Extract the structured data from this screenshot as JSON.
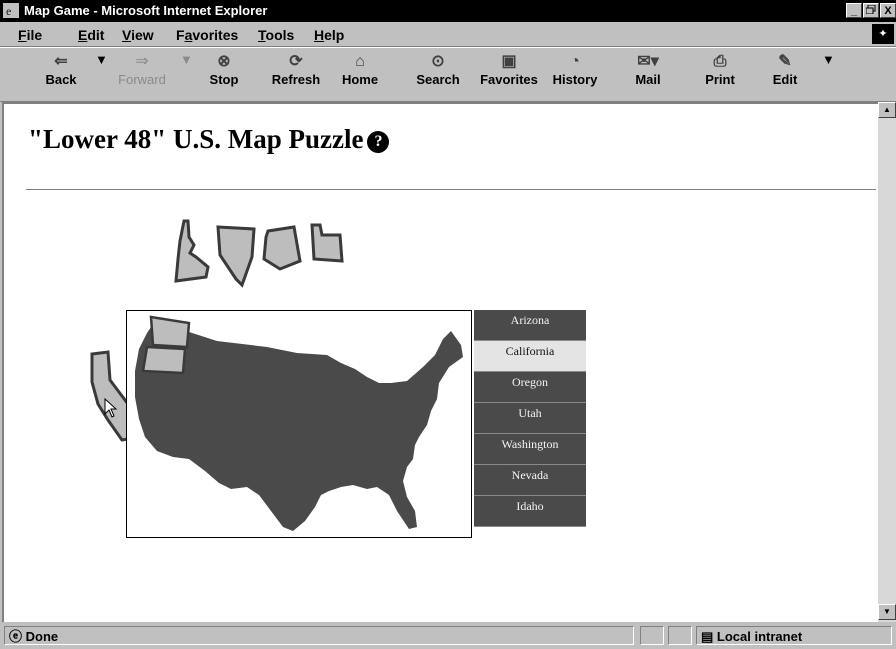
{
  "window": {
    "title": "Map Game - Microsoft Internet Explorer",
    "buttons": [
      "_",
      " ",
      "X"
    ]
  },
  "menu": [
    {
      "label": "File",
      "key": "F",
      "rest": "ile"
    },
    {
      "label": "Edit",
      "key": "E",
      "rest": "dit"
    },
    {
      "label": "View",
      "key": "V",
      "rest": "iew"
    },
    {
      "label": "Favorites",
      "key": "a",
      "rest": "vorites",
      "pre": "F"
    },
    {
      "label": "Tools",
      "key": "T",
      "rest": "ools"
    },
    {
      "label": "Help",
      "key": "H",
      "rest": "elp"
    }
  ],
  "toolbar": {
    "back": "Back",
    "forward": "Forward",
    "stop": "Stop",
    "refresh": "Refresh",
    "home": "Home",
    "search": "Search",
    "favorites": "Favorites",
    "history": "History",
    "mail": "Mail",
    "print": "Print",
    "edit": "Edit"
  },
  "page": {
    "title": "\"Lower 48\" U.S. Map Puzzle",
    "help_symbol": "?"
  },
  "states": [
    {
      "label": "Arizona",
      "selected": false
    },
    {
      "label": "California",
      "selected": true
    },
    {
      "label": "Oregon",
      "selected": false
    },
    {
      "label": "Utah",
      "selected": false
    },
    {
      "label": "Washington",
      "selected": false
    },
    {
      "label": "Nevada",
      "selected": false
    },
    {
      "label": "Idaho",
      "selected": false
    }
  ],
  "status": {
    "text": "Done",
    "zone": "Local intranet"
  },
  "colors": {
    "map_fill": "#4a4a4a",
    "piece_fill": "#bdbdbd",
    "selected_state": "#e4e4e4"
  }
}
